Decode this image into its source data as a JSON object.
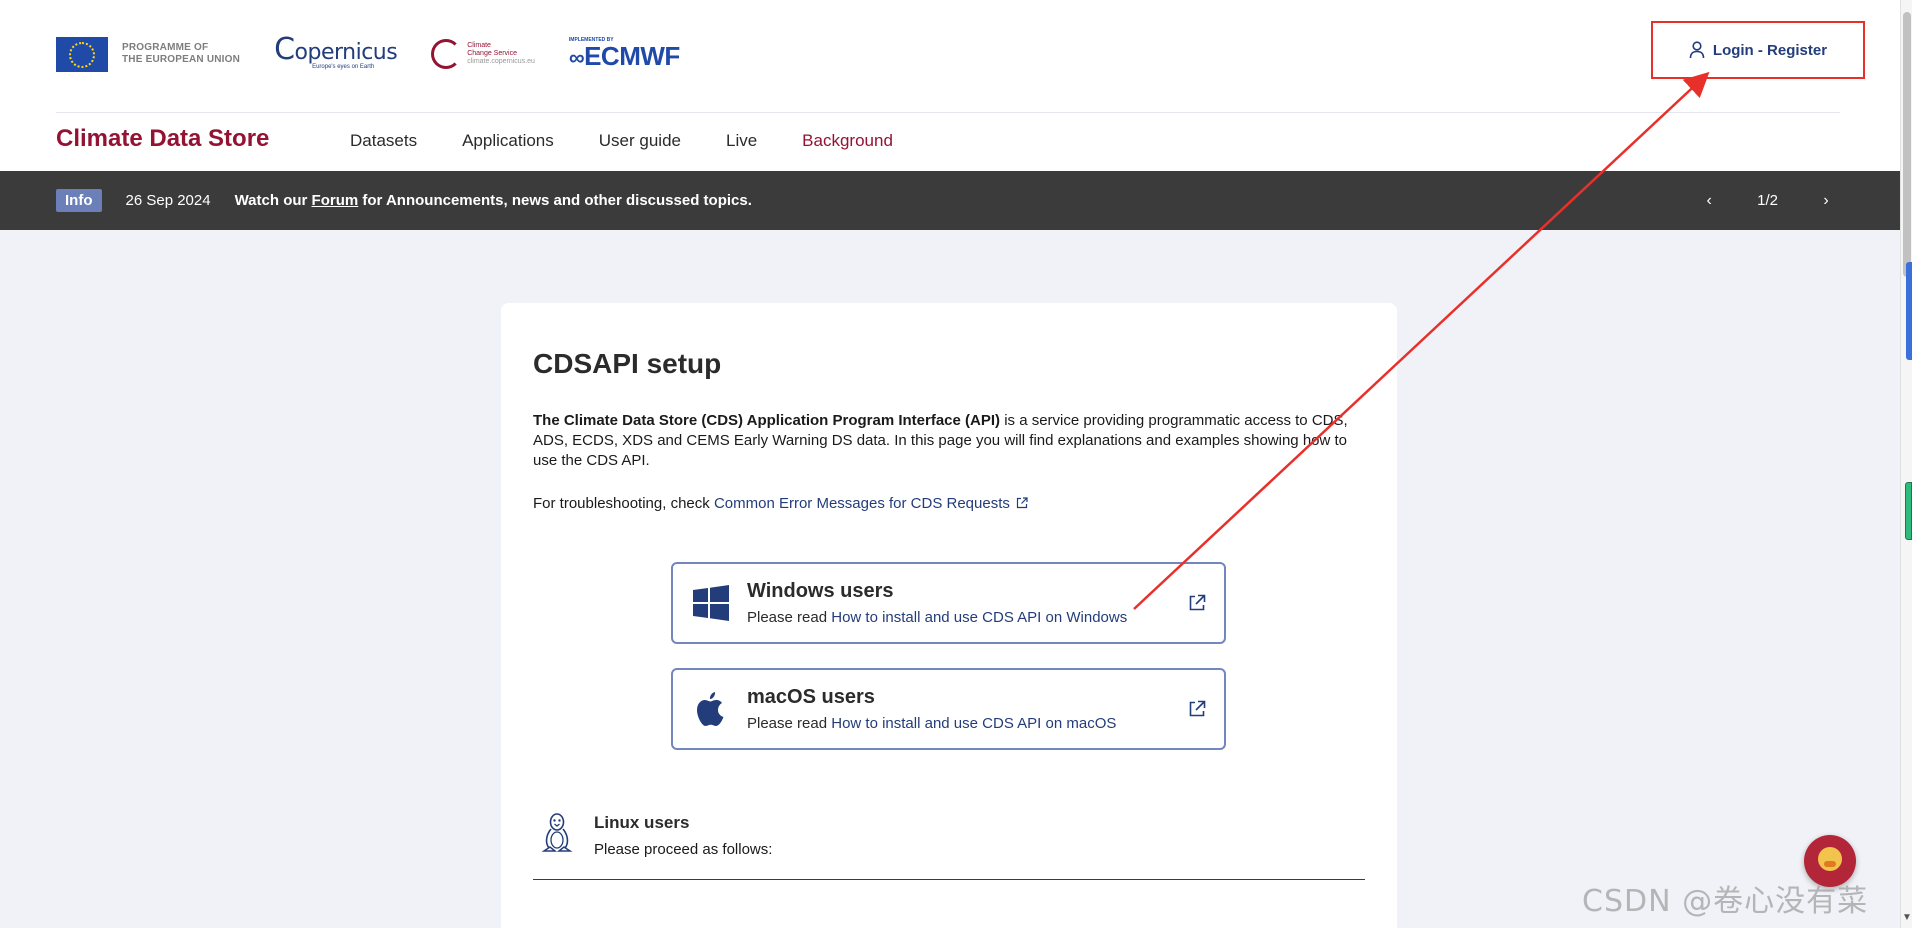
{
  "header": {
    "eu_logo_text_line1": "PROGRAMME OF",
    "eu_logo_text_line2": "THE EUROPEAN UNION",
    "copernicus_word": "opernicus",
    "copernicus_tag": "Europe's eyes on Earth",
    "c3s_line1": "Climate",
    "c3s_line2": "Change Service",
    "c3s_line3": "climate.copernicus.eu",
    "ecmwf_tag": "IMPLEMENTED BY",
    "ecmwf_word": "ECMWF",
    "login_label": "Login - Register",
    "brand": "Climate Data Store",
    "nav": [
      {
        "label": "Datasets"
      },
      {
        "label": "Applications"
      },
      {
        "label": "User guide"
      },
      {
        "label": "Live"
      },
      {
        "label": "Background"
      }
    ]
  },
  "infobar": {
    "badge": "Info",
    "date": "26 Sep 2024",
    "msg_prefix": "Watch our ",
    "msg_link": "Forum",
    "msg_suffix": " for Announcements, news and other discussed topics.",
    "page_indicator": "1/2",
    "prev_glyph": "‹",
    "next_glyph": "›"
  },
  "card": {
    "title": "CDSAPI setup",
    "intro_bold": "The Climate Data Store (CDS) Application Program Interface (API)",
    "intro_rest": " is a service providing programmatic access to CDS, ADS, ECDS, XDS and CEMS Early Warning DS data. In this page you will find explanations and examples showing how to use the CDS API.",
    "trouble_prefix": "For troubleshooting, check ",
    "trouble_link": "Common Error Messages for CDS Requests",
    "windows": {
      "title": "Windows users",
      "sub_prefix": "Please read ",
      "sub_link": "How to install and use CDS API on Windows"
    },
    "macos": {
      "title": "macOS users",
      "sub_prefix": "Please read ",
      "sub_link": "How to install and use CDS API on macOS"
    },
    "linux": {
      "title": "Linux users",
      "sub": "Please proceed as follows:"
    }
  },
  "overlay": {
    "watermark": "CSDN @卷心没有菜"
  },
  "colors": {
    "brand_red": "#941333",
    "link_blue": "#233d7a",
    "infobar_bg": "#3b3b3b",
    "page_bg": "#f0f2f7",
    "annotation_red": "#e8302b"
  }
}
